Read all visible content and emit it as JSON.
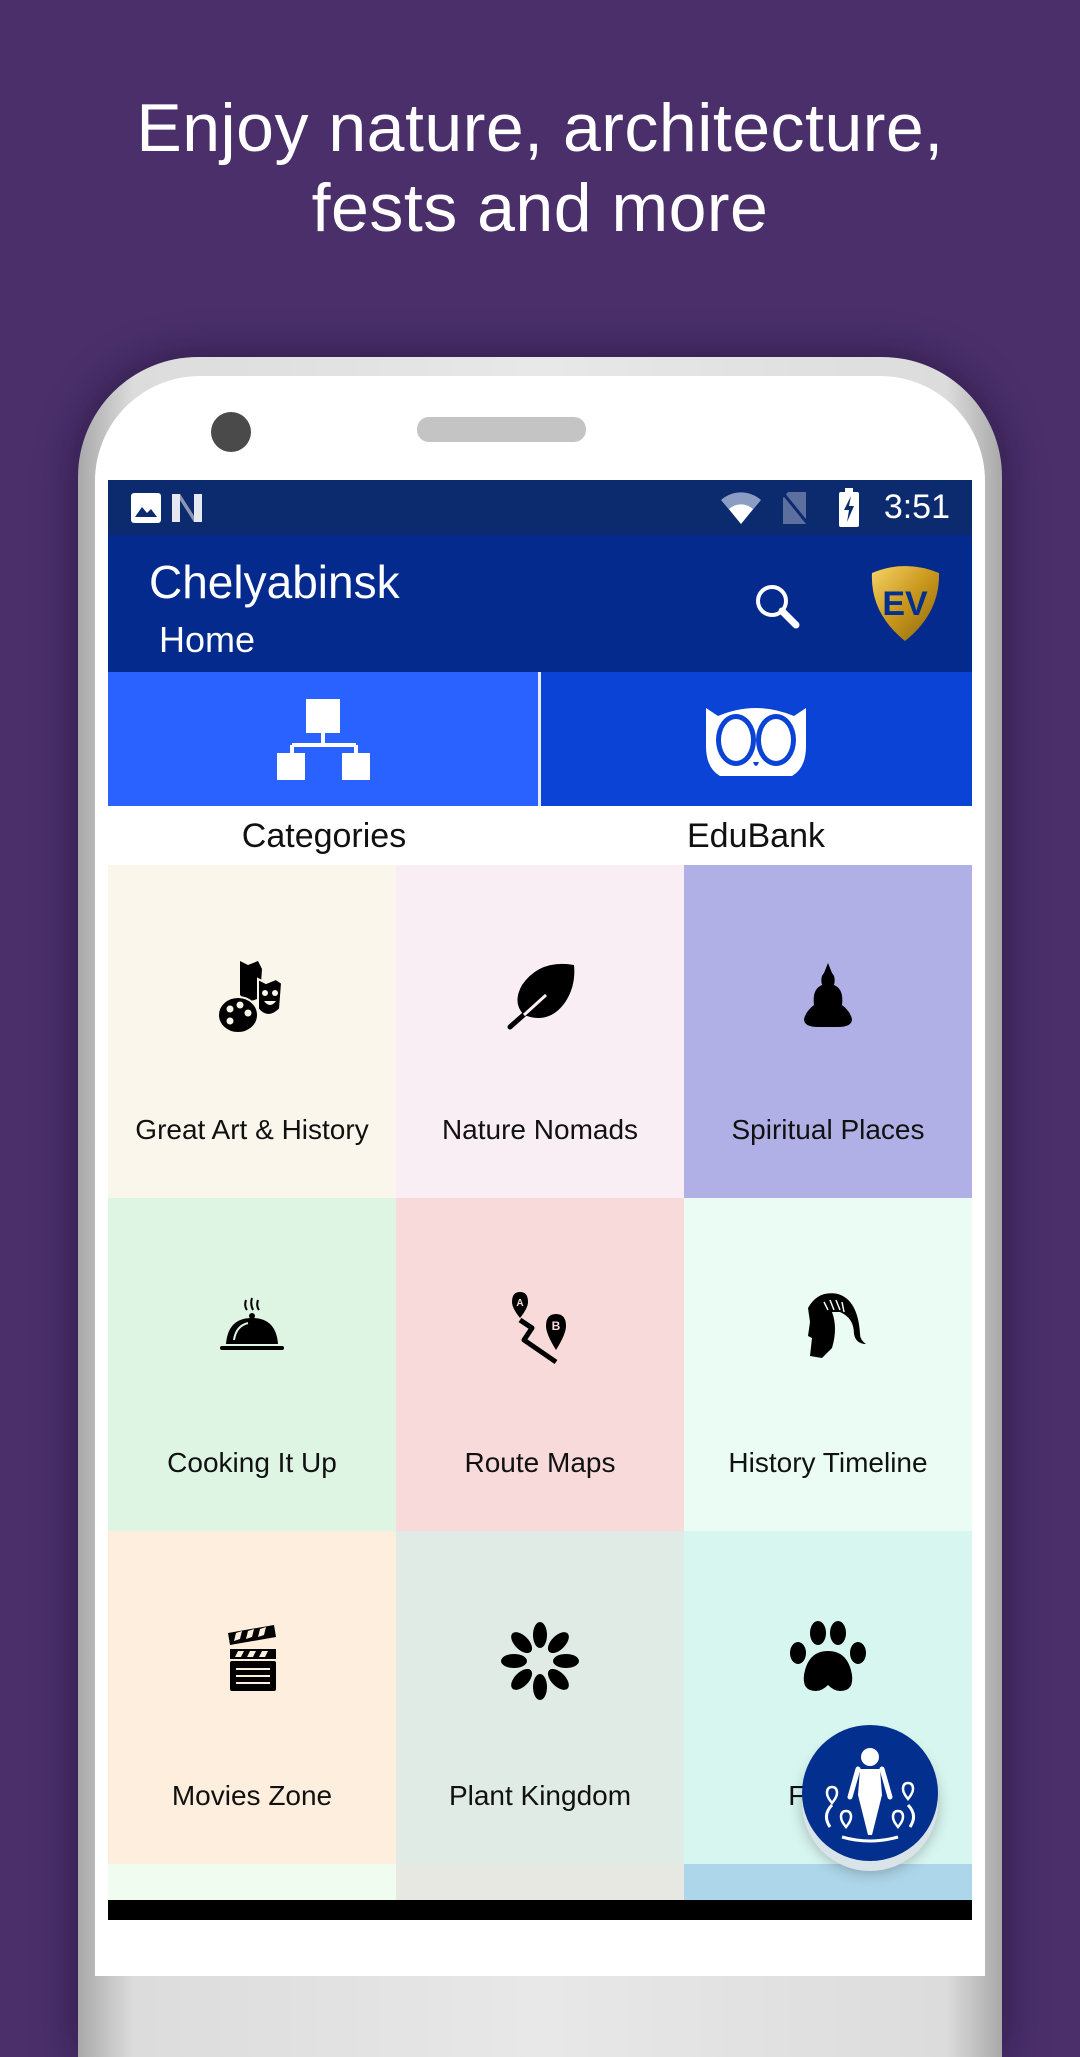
{
  "promo": {
    "headline_line1": "Enjoy nature, architecture,",
    "headline_line2": "fests and more"
  },
  "status_bar": {
    "time": "3:51",
    "icons": [
      "image-icon",
      "n-app-icon",
      "wifi-icon",
      "no-sim-icon",
      "battery-charging-icon"
    ]
  },
  "app_bar": {
    "title": "Chelyabinsk",
    "subtitle": "Home",
    "search_icon": "search-icon",
    "logo_text": "EV"
  },
  "tabs": [
    {
      "label": "Categories",
      "icon": "hierarchy-icon",
      "color": "#2962ff"
    },
    {
      "label": "EduBank",
      "icon": "owl-icon",
      "color": "#0a43d6"
    }
  ],
  "grid": [
    {
      "label": "Great Art & History",
      "icon": "art-masks-palette-icon",
      "bg": "#faf6eb"
    },
    {
      "label": "Nature Nomads",
      "icon": "leaf-icon",
      "bg": "#f9eef4"
    },
    {
      "label": "Spiritual Places",
      "icon": "buddha-icon",
      "bg": "#b0b0e6"
    },
    {
      "label": "Cooking It Up",
      "icon": "cloche-icon",
      "bg": "#ddf5e2"
    },
    {
      "label": "Route Maps",
      "icon": "route-map-icon",
      "bg": "#f8dada"
    },
    {
      "label": "History Timeline",
      "icon": "spartan-helmet-icon",
      "bg": "#ebfcf4"
    },
    {
      "label": "Movies Zone",
      "icon": "clapperboard-icon",
      "bg": "#fdeedd"
    },
    {
      "label": "Plant Kingdom",
      "icon": "flower-icon",
      "bg": "#e0ebe6"
    },
    {
      "label": "Fauna",
      "icon": "paw-icon",
      "bg": "#d8f6f0"
    }
  ],
  "grid_partial_row_colors": [
    "#f1fcf0",
    "#e8e8e2",
    "#add6ea"
  ],
  "fab": {
    "icon": "explore-nearby-icon",
    "color": "#03308f"
  },
  "colors": {
    "background": "#4a2f6b",
    "status_bar": "#0c2a6e",
    "app_bar": "#032a8c"
  }
}
